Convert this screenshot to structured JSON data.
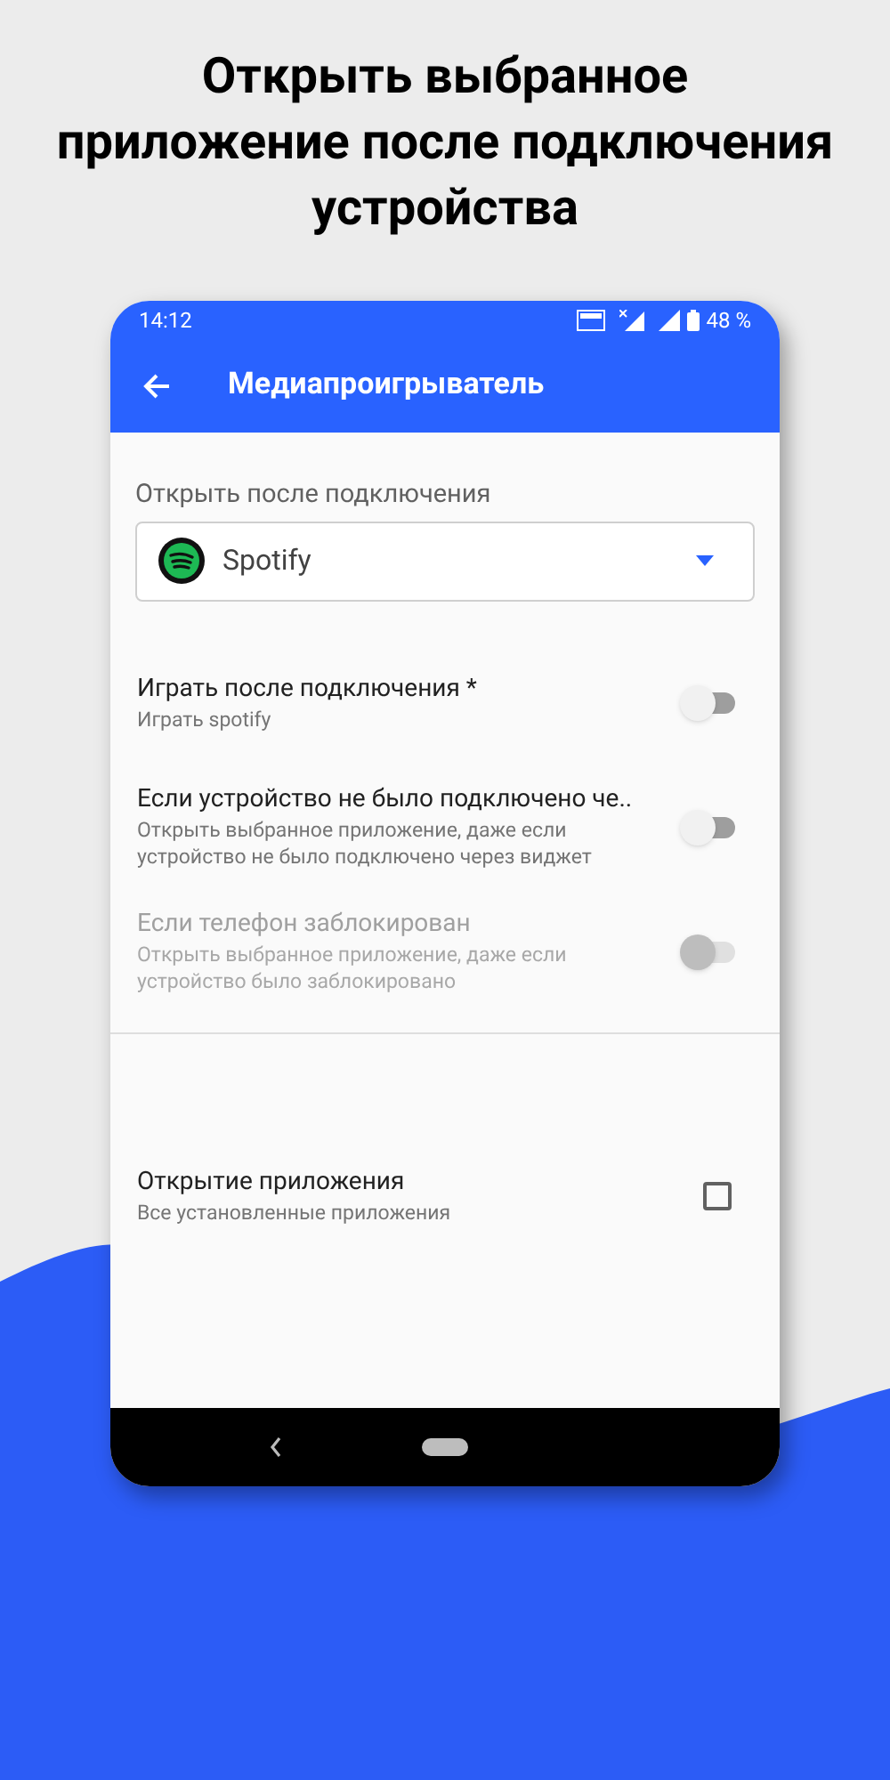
{
  "headline": "Открыть выбранное приложение после подключения устройства",
  "status_bar": {
    "time": "14:12",
    "battery": "48 %"
  },
  "toolbar": {
    "title": "Медиапроигрыватель"
  },
  "app_picker": {
    "label": "Открыть после подключения",
    "value": "Spotify"
  },
  "settings": [
    {
      "kind": "switch",
      "title": "Играть после подключения *",
      "subtitle": "Играть spotify",
      "on": false,
      "disabled": false
    },
    {
      "kind": "switch",
      "title": "Если устройство не было подключено че..",
      "subtitle": "Открыть выбранное приложение, даже если устройство не было подключено через виджет",
      "on": false,
      "disabled": false
    },
    {
      "kind": "switch",
      "title": "Если телефон заблокирован",
      "subtitle": "Открыть выбранное приложение, даже если устройство было заблокировано",
      "on": false,
      "disabled": true
    },
    {
      "kind": "divider"
    },
    {
      "kind": "checkbox",
      "title": "Открытие приложения",
      "subtitle": "Все установленные приложения",
      "checked": false,
      "disabled": false
    }
  ]
}
